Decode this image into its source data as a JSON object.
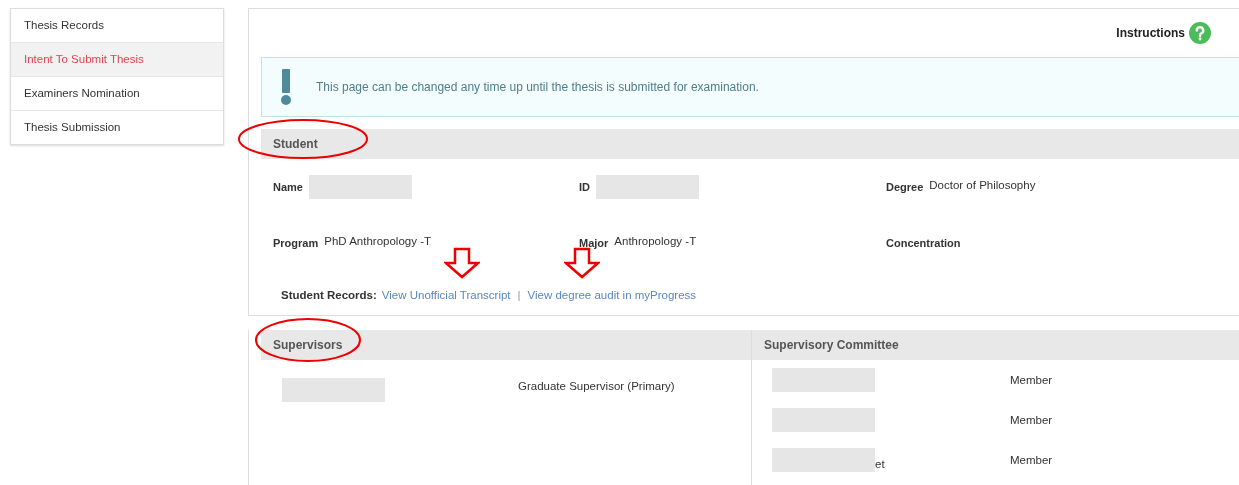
{
  "sidebar": {
    "items": [
      {
        "label": "Thesis Records",
        "selected": false
      },
      {
        "label": "Intent To Submit Thesis",
        "selected": true
      },
      {
        "label": "Examiners Nomination",
        "selected": false
      },
      {
        "label": "Thesis Submission",
        "selected": false
      }
    ]
  },
  "instructions": {
    "label": "Instructions"
  },
  "alert": {
    "text": "This page can be changed any time up until the thesis is submitted for examination."
  },
  "student": {
    "heading": "Student",
    "circled": true,
    "fields": [
      {
        "label": "Name",
        "redacted": true
      },
      {
        "label": "ID",
        "redacted": true
      },
      {
        "label": "Degree",
        "value": "Doctor of Philosophy",
        "redacted": false
      },
      {
        "label": "Program",
        "value": "PhD Anthropology -T",
        "redacted": false
      },
      {
        "label": "Major",
        "value": "Anthropology -T",
        "redacted": false
      },
      {
        "label": "Concentration",
        "redacted": false
      }
    ],
    "records": {
      "label": "Student Records:",
      "separator": "|",
      "links": [
        {
          "text": "View Unofficial Transcript",
          "arrow": true
        },
        {
          "text": "View degree audit in myProgress",
          "arrow": true
        }
      ]
    }
  },
  "supervisors": {
    "heading": "Supervisors",
    "circled": true,
    "rows": [
      {
        "redacted": true,
        "role": "Graduate Supervisor (Primary)"
      }
    ]
  },
  "committee": {
    "heading": "Supervisory Committee",
    "rows": [
      {
        "redacted": true,
        "role": "Member"
      },
      {
        "redacted": true,
        "role": "Member"
      },
      {
        "redacted": true,
        "suffix": "et",
        "role": "Member"
      }
    ]
  }
}
